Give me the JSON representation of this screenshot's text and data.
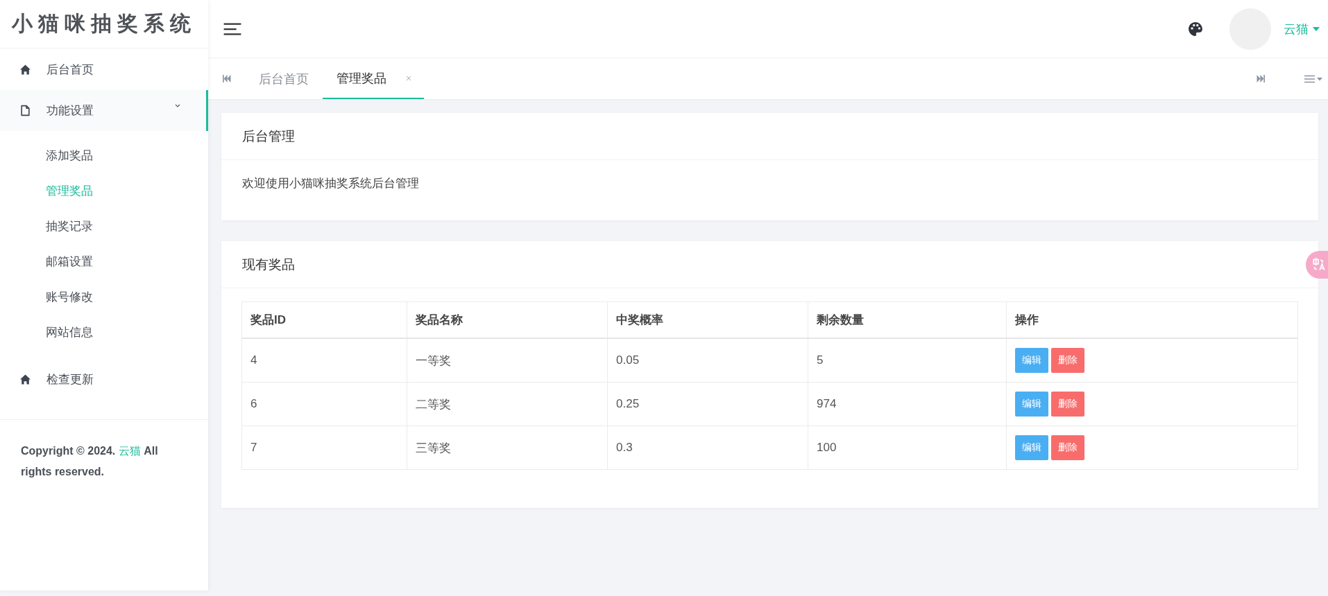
{
  "sidebar": {
    "logo": "小猫咪抽奖系统",
    "menu": [
      {
        "label": "后台首页",
        "kind": "home",
        "selected": false,
        "expanded": false
      },
      {
        "label": "功能设置",
        "kind": "file",
        "selected": false,
        "expanded": true,
        "children": [
          {
            "label": "添加奖品",
            "selected": false
          },
          {
            "label": "管理奖品",
            "selected": true
          },
          {
            "label": "抽奖记录",
            "selected": false
          },
          {
            "label": "邮箱设置",
            "selected": false
          },
          {
            "label": "账号修改",
            "selected": false
          },
          {
            "label": "网站信息",
            "selected": false
          }
        ]
      },
      {
        "label": "检查更新",
        "kind": "home",
        "selected": false,
        "expanded": false
      }
    ],
    "copyright": {
      "before": "Copyright © 2024.",
      "link": "云猫",
      "after": "All rights reserved."
    }
  },
  "header": {
    "user": "云猫"
  },
  "tabs": [
    {
      "label": "后台首页",
      "selected": false,
      "closable": false
    },
    {
      "label": "管理奖品",
      "selected": true,
      "closable": true
    }
  ],
  "welcome_card": {
    "title": "后台管理",
    "text": "欢迎使用小猫咪抽奖系统后台管理"
  },
  "prizes_card": {
    "title": "现有奖品",
    "columns": [
      "奖品ID",
      "奖品名称",
      "中奖概率",
      "剩余数量",
      "操作"
    ],
    "rows": [
      {
        "cells": [
          "4",
          "一等奖",
          "0.05",
          "5"
        ],
        "actions": [
          {
            "label": "编辑",
            "kind": "edit"
          },
          {
            "label": "删除",
            "kind": "delete"
          }
        ]
      },
      {
        "cells": [
          "6",
          "二等奖",
          "0.25",
          "974"
        ],
        "actions": [
          {
            "label": "编辑",
            "kind": "edit"
          },
          {
            "label": "删除",
            "kind": "delete"
          }
        ]
      },
      {
        "cells": [
          "7",
          "三等奖",
          "0.3",
          "100"
        ],
        "actions": [
          {
            "label": "编辑",
            "kind": "edit"
          },
          {
            "label": "删除",
            "kind": "delete"
          }
        ]
      }
    ]
  }
}
